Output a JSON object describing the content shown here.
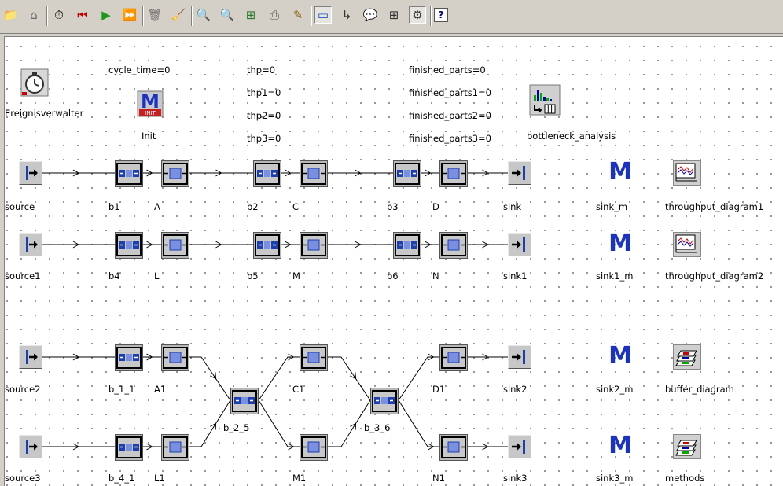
{
  "toolbar": {
    "buttons": [
      {
        "name": "open-folder",
        "glyph": "📁",
        "color": "#8a6d1c"
      },
      {
        "name": "home",
        "glyph": "⌂",
        "color": "#6a6a6a"
      },
      {
        "name": "clock",
        "glyph": "⏱",
        "color": "#000000"
      },
      {
        "name": "reset-to-start",
        "glyph": "⏮",
        "color": "#c00000"
      },
      {
        "name": "start",
        "glyph": "▶",
        "color": "#1a9a1a"
      },
      {
        "name": "fast-forward",
        "glyph": "⏩",
        "color": "#1a4fc4"
      },
      {
        "name": "delete",
        "glyph": "🗑",
        "color": "#707070"
      },
      {
        "name": "clean",
        "glyph": "🧹",
        "color": "#555555"
      },
      {
        "name": "zoom-in",
        "glyph": "🔍",
        "color": "#2a3a9a"
      },
      {
        "name": "zoom-out",
        "glyph": "🔍",
        "color": "#2a3a9a"
      },
      {
        "name": "layout",
        "glyph": "⊞",
        "color": "#2a7a2a"
      },
      {
        "name": "print",
        "glyph": "⎙",
        "color": "#555555"
      },
      {
        "name": "pencil",
        "glyph": "✎",
        "color": "#8a5a00"
      },
      {
        "name": "eraser",
        "glyph": "▭",
        "color": "#1a4fc4"
      },
      {
        "name": "connector",
        "glyph": "↳",
        "color": "#333333"
      },
      {
        "name": "comment",
        "glyph": "💬",
        "color": "#c03030"
      },
      {
        "name": "grid",
        "glyph": "⊞",
        "color": "#333333"
      },
      {
        "name": "tools",
        "glyph": "⚙",
        "color": "#333333"
      },
      {
        "name": "help",
        "glyph": "?",
        "color": "#000080"
      }
    ]
  },
  "info": {
    "cycle_time": "cycle_time=0",
    "thp": "thp=0",
    "thp1": "thp1=0",
    "thp2": "thp2=0",
    "thp3": "thp3=0",
    "finished_parts": "finished_parts=0",
    "finished_parts1": "finished_parts1=0",
    "finished_parts2": "finished_parts2=0",
    "finished_parts3": "finished_parts3=0"
  },
  "objects": {
    "eventcontroller": "Ereignisverwalter",
    "init": "Init",
    "init_badge": "INIT",
    "bottleneck": "bottleneck_analysis",
    "source": "source",
    "b1": "b1",
    "A": "A",
    "b2": "b2",
    "C": "C",
    "b3": "b3",
    "D": "D",
    "sink": "sink",
    "sink_m": "sink_m",
    "tdiag1": "throughput_diagram1",
    "source1": "source1",
    "b4": "b4",
    "L": "L",
    "b5": "b5",
    "M": "M",
    "b6": "b6",
    "N": "N",
    "sink1": "sink1",
    "sink1_m": "sink1_m",
    "tdiag2": "throughput_diagram2",
    "source2": "source2",
    "b_1_1": "b_1_1",
    "A1": "A1",
    "b_2_5": "b_2_5",
    "C1": "C1",
    "b_3_6": "b_3_6",
    "D1": "D1",
    "sink2": "sink2",
    "sink2_m": "sink2_m",
    "buffer_diagram": "buffer_diagram",
    "source3": "source3",
    "b_4_1": "b_4_1",
    "L1": "L1",
    "M1": "M1",
    "N1": "N1",
    "sink3": "sink3",
    "sink3_m": "sink3_m",
    "methods": "methods"
  },
  "method_glyph": "M",
  "colors": {
    "icon_face": "#c8c8c8",
    "machine_blue": "#7a8fe0",
    "buffer_blue": "#1a3fb0",
    "method_blue": "#1a33c4",
    "init_red": "#c82020"
  }
}
